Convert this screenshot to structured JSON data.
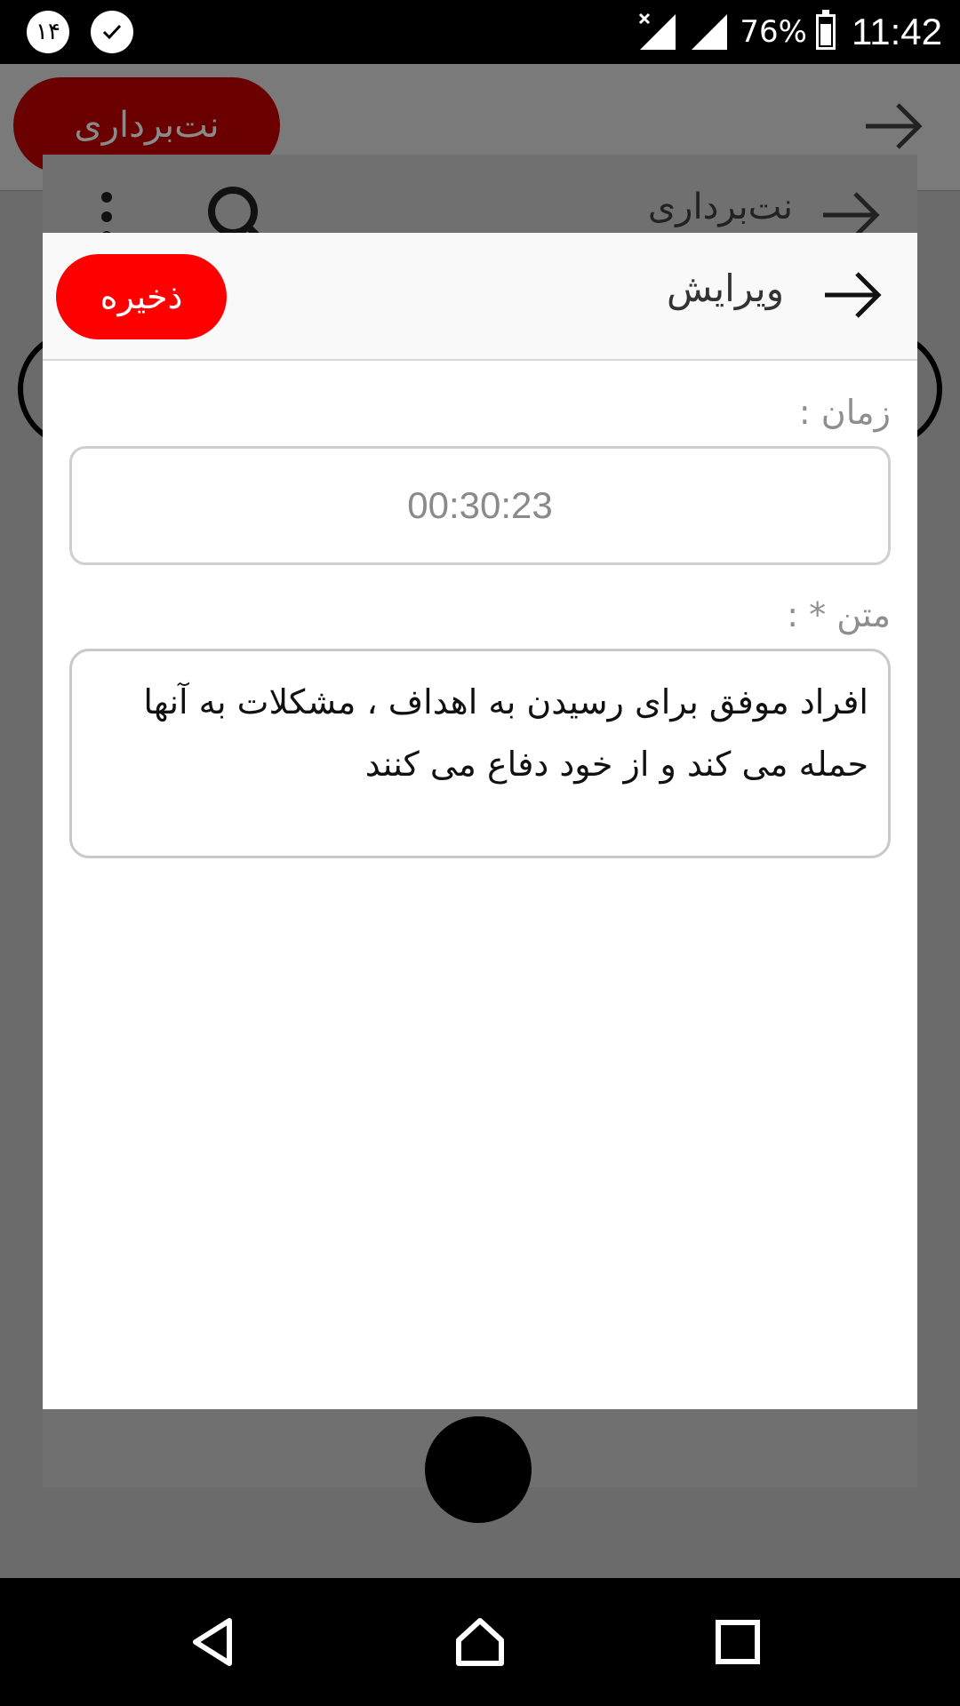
{
  "status_bar": {
    "notification_count": "۱۴",
    "battery_percent": "76%",
    "time": "11:42",
    "icons": [
      "notification-count-icon",
      "check-circle-icon",
      "signal-no-data-icon",
      "signal-icon",
      "battery-icon"
    ]
  },
  "background_app": {
    "pill_label": "نت‌برداری",
    "card_title": "نت‌برداری"
  },
  "dialog": {
    "title": "ویرایش",
    "save_label": "ذخیره",
    "time_label": "زمان :",
    "time_value": "00:30:23",
    "text_label": "متن * :",
    "text_value": "افراد موفق برای رسیدن به اهداف ، مشکلات به آنها حمله می کند و از خود دفاع می کنند"
  },
  "colors": {
    "save_button": "#ff0000",
    "background_pill": "#6a0000"
  },
  "nav_bar": {
    "icons": [
      "back-icon",
      "home-icon",
      "recents-icon"
    ]
  }
}
